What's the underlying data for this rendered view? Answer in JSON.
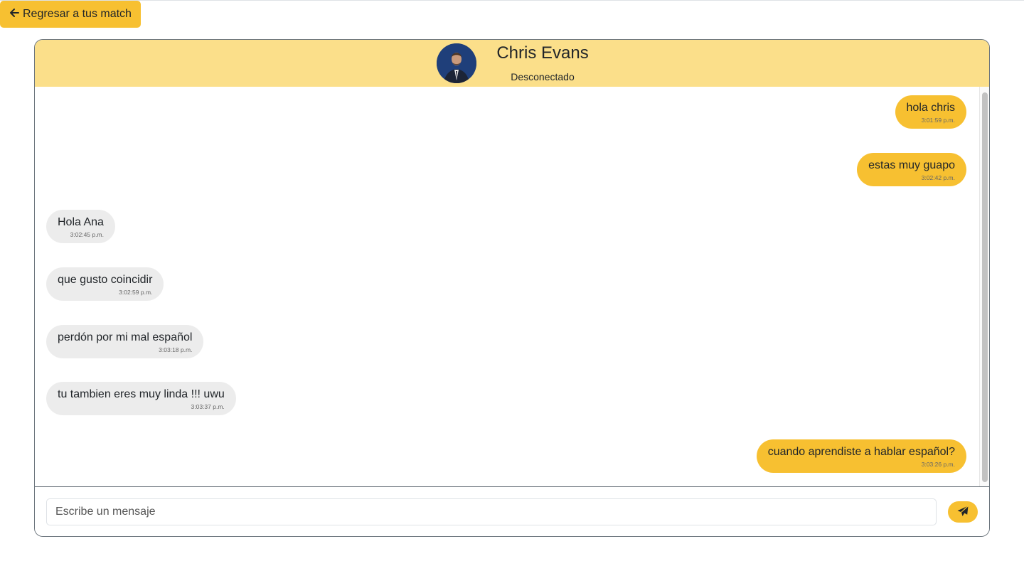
{
  "nav": {
    "back_label": "Regresar a tus match"
  },
  "header": {
    "contact_name": "Chris Evans",
    "status": "Desconectado"
  },
  "messages": [
    {
      "side": "sent",
      "text": "hola chris",
      "time": "3:01:59 p.m."
    },
    {
      "side": "sent",
      "text": "estas muy guapo",
      "time": "3:02:42 p.m."
    },
    {
      "side": "recv",
      "text": "Hola Ana",
      "time": "3:02:45 p.m."
    },
    {
      "side": "recv",
      "text": "que gusto coincidir",
      "time": "3:02:59 p.m."
    },
    {
      "side": "recv",
      "text": "perdón por mi mal español",
      "time": "3:03:18 p.m."
    },
    {
      "side": "recv",
      "text": "tu tambien eres muy linda !!! uwu",
      "time": "3:03:37 p.m."
    },
    {
      "side": "sent",
      "text": "cuando aprendiste a hablar español?",
      "time": "3:03:26 p.m."
    }
  ],
  "composer": {
    "placeholder": "Escribe un mensaje",
    "value": ""
  },
  "icons": {
    "back": "arrow-left-icon",
    "send": "paper-plane-icon"
  },
  "colors": {
    "accent": "#f7c031",
    "header_bg": "#fbdf8a",
    "received_bubble": "#ececec"
  }
}
